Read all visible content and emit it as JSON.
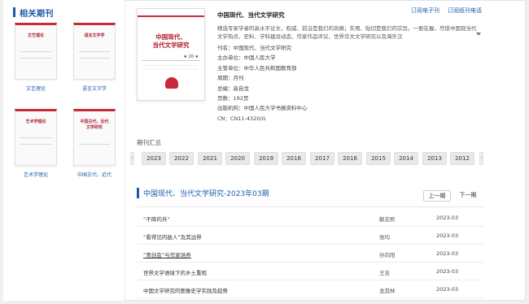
{
  "sidebar": {
    "title": "相关期刊",
    "items": [
      {
        "cover_title": "文艺理论",
        "caption": "文艺理论"
      },
      {
        "cover_title": "语言文字学",
        "caption": "语言文字学"
      },
      {
        "cover_title": "艺术学理论",
        "caption": "艺术学理论"
      },
      {
        "cover_title": "中国古代、近代文学研究",
        "caption": "中国古代、近代"
      }
    ]
  },
  "journal": {
    "cover_title_line1": "中国现代、",
    "cover_title_line2": "当代文学研究",
    "cover_issue": "★ 10 ★",
    "title": "中国现代、当代文学研究",
    "links": {
      "ejournal": "订阅电子刊",
      "paper": "订阅纸刊电话"
    },
    "description": "精选专家学者的高水平论文，权威、前沿是我们的风格；实用、贴切是我们的宗旨。一册在握，尽揽中国现当代文学热点、史料、学科建设动态、作家作品评议、世界华文文学研究以及海外汉",
    "meta": [
      "刊名：中国现代、当代文学研究",
      "主办单位：中国人民大学",
      "主管单位：中华人民共和国教育部",
      "周期：月刊",
      "总编：高自龙",
      "页数：192页",
      "出版机构：中国人民大学书报资料中心",
      "CN：CN11-4320/G"
    ]
  },
  "period": {
    "title": "期刊汇总",
    "years": [
      "2023",
      "2022",
      "2021",
      "2020",
      "2019",
      "2018",
      "2017",
      "2016",
      "2015",
      "2014",
      "2013",
      "2012"
    ]
  },
  "issue": {
    "heading": "中国现代、当代文学研究-2023年03期",
    "prev": "上一期",
    "next": "下一期",
    "articles": [
      {
        "title": "“不降的兵”",
        "author": "解志熙",
        "date": "2023-03"
      },
      {
        "title": "“看得见的敌人”及其边界",
        "author": "张均",
        "date": "2023-03"
      },
      {
        "title": "“青创会”与作家培养",
        "author": "孙向阳",
        "date": "2023-03"
      },
      {
        "title": "世界文学语境下的乡土重观",
        "author": "王吉",
        "date": "2023-03"
      },
      {
        "title": "中国文学研究的图像史学实践及趋势",
        "author": "龙其林",
        "date": "2023-03"
      }
    ]
  },
  "colors": {
    "accent": "#1a5bab",
    "cover_red": "#c8293b"
  }
}
